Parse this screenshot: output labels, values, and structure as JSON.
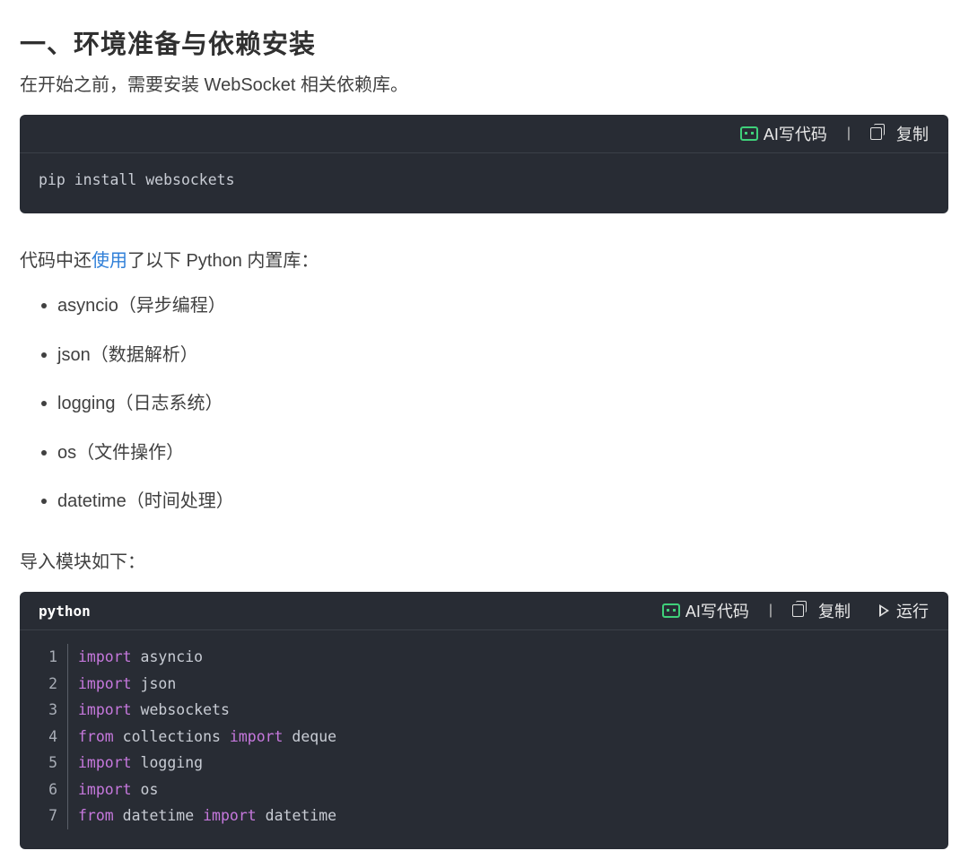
{
  "heading": "一、环境准备与依赖安装",
  "intro": "在开始之前，需要安装 WebSocket 相关依赖库。",
  "code_block_1": {
    "ai_label": "AI写代码",
    "separator": "|",
    "copy_label": "复制",
    "code": "pip install websockets"
  },
  "builtin_intro": {
    "before": "代码中还",
    "link": "使用",
    "after": "了以下 Python 内置库："
  },
  "libraries": [
    "asyncio（异步编程）",
    "json（数据解析）",
    "logging（日志系统）",
    "os（文件操作）",
    "datetime（时间处理）"
  ],
  "import_intro": "导入模块如下：",
  "code_block_2": {
    "language": "python",
    "ai_label": "AI写代码",
    "separator": "|",
    "copy_label": "复制",
    "run_label": "运行",
    "lines": [
      {
        "n": "1",
        "kw1": "import",
        "t1": " asyncio",
        "kw2": "",
        "t2": ""
      },
      {
        "n": "2",
        "kw1": "import",
        "t1": " json",
        "kw2": "",
        "t2": ""
      },
      {
        "n": "3",
        "kw1": "import",
        "t1": " websockets",
        "kw2": "",
        "t2": ""
      },
      {
        "n": "4",
        "kw1": "from",
        "t1": " collections ",
        "kw2": "import",
        "t2": " deque"
      },
      {
        "n": "5",
        "kw1": "import",
        "t1": " logging",
        "kw2": "",
        "t2": ""
      },
      {
        "n": "6",
        "kw1": "import",
        "t1": " os",
        "kw2": "",
        "t2": ""
      },
      {
        "n": "7",
        "kw1": "from",
        "t1": " datetime ",
        "kw2": "import",
        "t2": " datetime"
      }
    ]
  },
  "colors": {
    "code_bg": "#282c34",
    "keyword": "#c678dd",
    "link": "#2f7fd8",
    "ai_icon": "#3fd07a"
  }
}
